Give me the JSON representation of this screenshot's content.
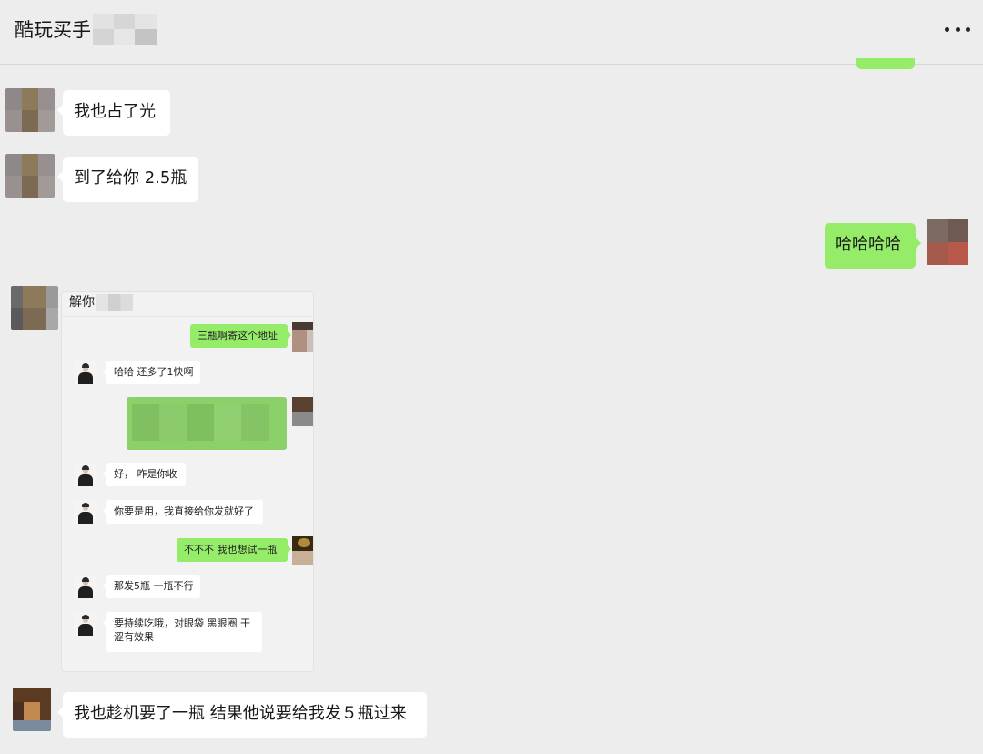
{
  "header": {
    "title": "酷玩买手",
    "more_icon": "more-horizontal-icon"
  },
  "messages": [
    {
      "side": "incoming",
      "text": "我也占了光"
    },
    {
      "side": "incoming",
      "text": "到了给你 2.5瓶"
    },
    {
      "side": "outgoing",
      "text": "哈哈哈哈"
    },
    {
      "side": "incoming",
      "type": "image",
      "embedded_chat": {
        "title": "解你",
        "messages": [
          {
            "side": "outgoing",
            "text": "三瓶啊寄这个地址"
          },
          {
            "side": "incoming",
            "text": "哈哈 还多了1快啊"
          },
          {
            "side": "outgoing",
            "text": ""
          },
          {
            "side": "incoming",
            "text": "好， 咋是你收"
          },
          {
            "side": "incoming",
            "text": "你要是用，我直接给你发就好了"
          },
          {
            "side": "outgoing",
            "text": "不不不 我也想试一瓶"
          },
          {
            "side": "incoming",
            "text": "那发5瓶 一瓶不行"
          },
          {
            "side": "incoming",
            "text_line1": "要持续吃哦，对眼袋 黑眼圈 干",
            "text_line2": "涩有效果"
          }
        ]
      }
    },
    {
      "side": "incoming",
      "text": "我也趁机要了一瓶 结果他说要给我发５瓶过来"
    }
  ],
  "colors": {
    "background": "#ededed",
    "incoming_bubble": "#ffffff",
    "outgoing_bubble": "#95ec69"
  }
}
